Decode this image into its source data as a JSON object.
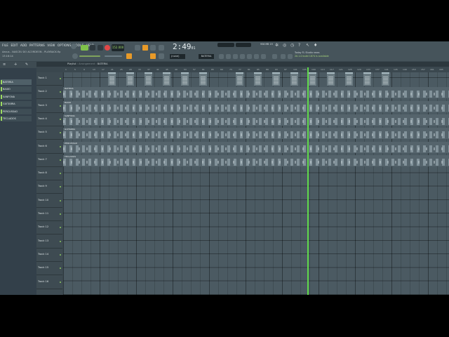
{
  "menu": [
    "FILE",
    "EDIT",
    "ADD",
    "PATTERNS",
    "VIEW",
    "OPTIONS",
    "TOOLS",
    "HELP"
  ],
  "song": {
    "title": "Aevus - NASCEU DO ACORDEON - PLAYBACK.flp",
    "time": "13:16:14"
  },
  "transport": {
    "tempo": "152.000",
    "clock_main": "2:49",
    "clock_sub": "01"
  },
  "cpu": {
    "memory": "956 MB",
    "voices": "19"
  },
  "toolbar": {
    "mode_label": "(none)",
    "pattern_label": "BATERIA"
  },
  "hint": {
    "line1": "Today FL Studio news",
    "line2": "20.1.0 build 1874 is available"
  },
  "playlist": {
    "title": "Playlist",
    "crumb": "Arrangement",
    "pattern": "BATERIA"
  },
  "browser": {
    "channels": [
      "BATERIA",
      "BAIXO",
      "SANFONA",
      "GUITARRA",
      "PERCUSSAO",
      "TECLADOS"
    ]
  },
  "tracks": [
    "Track 1",
    "Track 2",
    "Track 3",
    "Track 4",
    "Track 5",
    "Track 6",
    "Track 7",
    "Track 8",
    "Track 9",
    "Track 10",
    "Track 11",
    "Track 12",
    "Track 13",
    "Track 14",
    "Track 15",
    "Track 16"
  ],
  "lanes": [
    "BATERIA",
    "BAIXO",
    "SANFONA",
    "GUITARRA",
    "PERCUSSAO",
    "TECLADOS"
  ],
  "ruler": [
    "1",
    "5",
    "9",
    "13",
    "17",
    "21",
    "25",
    "29",
    "33",
    "37",
    "41",
    "45",
    "49",
    "53",
    "57",
    "61",
    "65",
    "69",
    "73",
    "77",
    "81",
    "85",
    "89",
    "93",
    "97",
    "101",
    "105",
    "109",
    "113",
    "117",
    "121",
    "125",
    "129",
    "133",
    "137",
    "141",
    "145",
    "149",
    "153",
    "157",
    "161",
    "165"
  ],
  "colors": {
    "accent": "#e89a28",
    "playhead": "#5fd84a",
    "record": "#e04747"
  }
}
